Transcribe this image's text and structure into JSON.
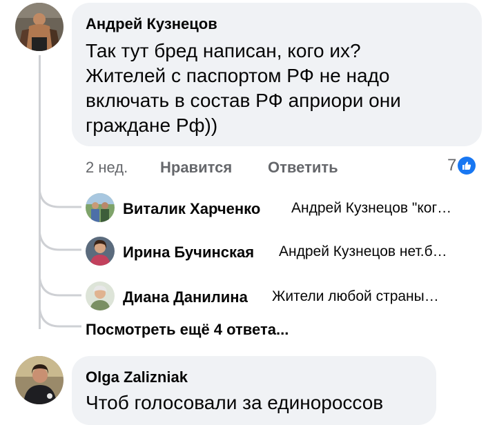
{
  "comments": [
    {
      "author": "Андрей Кузнецов",
      "lines": [
        "Так тут бред написан, кого их?",
        "Жителей с паспортом РФ не надо",
        "включать в состав РФ априори они",
        "граждане Рф))"
      ],
      "time": "2 нед.",
      "like_label": "Нравится",
      "reply_label": "Ответить",
      "reaction_count": "7",
      "reaction_icon": "like-icon"
    },
    {
      "author": "Olga Zalizniak",
      "lines": [
        "Чтоб голосовали за единороссов"
      ]
    }
  ],
  "replies": [
    {
      "author": "Виталик Харченко",
      "preview": "Андрей Кузнецов \"ког…"
    },
    {
      "author": "Ирина Бучинская",
      "preview": "Андрей Кузнецов нет.б…"
    },
    {
      "author": "Диана Данилина",
      "preview": "Жители любой страны…"
    }
  ],
  "view_more": "Посмотреть ещё 4 ответа...",
  "colors": {
    "bubble": "#f0f2f5",
    "secondary_text": "#65676b",
    "like_blue": "#1877f2",
    "thread_line": "#ced0d4"
  }
}
